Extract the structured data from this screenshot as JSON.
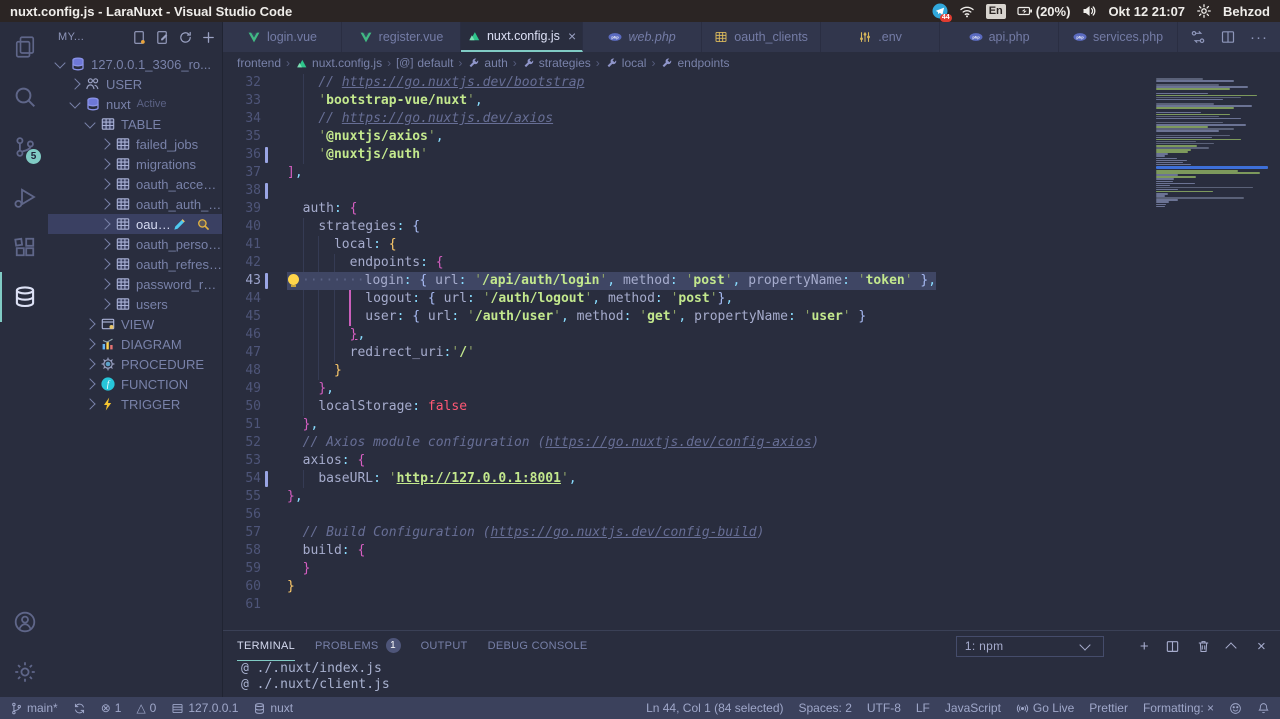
{
  "window": {
    "title": "nuxt.config.js - LaraNuxt - Visual Studio Code"
  },
  "tray": {
    "telegram_badge": "44",
    "keyboard_layout": "En",
    "battery": "(20%)",
    "clock": "Okt 12 21:07",
    "user": "Behzod"
  },
  "activity_bar": {
    "scm_badge": "5"
  },
  "sidebar": {
    "header": {
      "title": "MY..."
    },
    "tree": [
      {
        "label": "127.0.0.1_3306_ro...",
        "depth": 0,
        "icon": "database",
        "chevron": "open"
      },
      {
        "label": "USER",
        "depth": 1,
        "icon": "people",
        "chevron": "closed"
      },
      {
        "label": "nuxt",
        "badge": "Active",
        "depth": 1,
        "icon": "database",
        "chevron": "open"
      },
      {
        "label": "TABLE",
        "depth": 2,
        "icon": "grid",
        "chevron": "open"
      },
      {
        "label": "failed_jobs",
        "depth": 3,
        "icon": "grid",
        "chevron": "closed"
      },
      {
        "label": "migrations",
        "depth": 3,
        "icon": "grid",
        "chevron": "closed"
      },
      {
        "label": "oauth_access...",
        "depth": 3,
        "icon": "grid",
        "chevron": "closed"
      },
      {
        "label": "oauth_auth_c...",
        "depth": 3,
        "icon": "grid",
        "chevron": "closed"
      },
      {
        "label": "oauth_...",
        "depth": 3,
        "icon": "grid",
        "chevron": "closed",
        "selected": true,
        "actions": [
          "pencil",
          "magnifier"
        ]
      },
      {
        "label": "oauth_person...",
        "depth": 3,
        "icon": "grid",
        "chevron": "closed"
      },
      {
        "label": "oauth_refresh...",
        "depth": 3,
        "icon": "grid",
        "chevron": "closed"
      },
      {
        "label": "password_res...",
        "depth": 3,
        "icon": "grid",
        "chevron": "closed"
      },
      {
        "label": "users",
        "depth": 3,
        "icon": "grid",
        "chevron": "closed"
      },
      {
        "label": "VIEW",
        "depth": 2,
        "icon": "view",
        "chevron": "closed"
      },
      {
        "label": "DIAGRAM",
        "depth": 2,
        "icon": "diagram",
        "chevron": "closed"
      },
      {
        "label": "PROCEDURE",
        "depth": 2,
        "icon": "gear",
        "chevron": "closed"
      },
      {
        "label": "FUNCTION",
        "depth": 2,
        "icon": "func",
        "chevron": "closed"
      },
      {
        "label": "TRIGGER",
        "depth": 2,
        "icon": "bolt",
        "chevron": "closed"
      }
    ]
  },
  "tabs": [
    {
      "label": "login.vue",
      "icon": "vue"
    },
    {
      "label": "register.vue",
      "icon": "vue"
    },
    {
      "label": "nuxt.config.js",
      "icon": "nuxt",
      "active": true,
      "close": "×"
    },
    {
      "label": "web.php",
      "icon": "php",
      "preview": true
    },
    {
      "label": "oauth_clients",
      "icon": "gridy"
    },
    {
      "label": ".env",
      "icon": "env"
    },
    {
      "label": "api.php",
      "icon": "php"
    },
    {
      "label": "services.php",
      "icon": "php"
    }
  ],
  "breadcrumbs": [
    {
      "label": "frontend"
    },
    {
      "label": "nuxt.config.js",
      "icon": "nuxt"
    },
    {
      "label": "default",
      "icon": "module"
    },
    {
      "label": "auth",
      "icon": "wrench"
    },
    {
      "label": "strategies",
      "icon": "wrench"
    },
    {
      "label": "local",
      "icon": "wrench"
    },
    {
      "label": "endpoints",
      "icon": "wrench"
    }
  ],
  "editor": {
    "lines": [
      {
        "n": 32,
        "ind": 4,
        "tk": [
          [
            "    ",
            "pl"
          ],
          [
            "// ",
            "c"
          ],
          [
            "https://go.nuxtjs.dev/bootstrap",
            "cu"
          ]
        ]
      },
      {
        "n": 33,
        "ind": 4,
        "tk": [
          [
            "    ",
            "pl"
          ],
          [
            "'",
            "q"
          ],
          [
            "bootstrap-vue/nuxt",
            "s"
          ],
          [
            "'",
            "q"
          ],
          [
            ",",
            "p"
          ]
        ]
      },
      {
        "n": 34,
        "ind": 4,
        "tk": [
          [
            "    ",
            "pl"
          ],
          [
            "// ",
            "c"
          ],
          [
            "https://go.nuxtjs.dev/axios",
            "cu"
          ]
        ]
      },
      {
        "n": 35,
        "ind": 4,
        "tk": [
          [
            "    ",
            "pl"
          ],
          [
            "'",
            "q"
          ],
          [
            "@nuxtjs/axios",
            "s"
          ],
          [
            "'",
            "q"
          ],
          [
            ",",
            "p"
          ]
        ]
      },
      {
        "n": 36,
        "ind": 4,
        "git": true,
        "tk": [
          [
            "    ",
            "pl"
          ],
          [
            "'",
            "q"
          ],
          [
            "@nuxtjs/auth",
            "s"
          ],
          [
            "'",
            "q"
          ]
        ]
      },
      {
        "n": 37,
        "ind": 0,
        "tk": [
          [
            "]",
            "b2"
          ],
          [
            ",",
            "p"
          ]
        ]
      },
      {
        "n": 38,
        "ind": 0,
        "git": true,
        "tk": []
      },
      {
        "n": 39,
        "ind": 2,
        "tk": [
          [
            "  ",
            "pl"
          ],
          [
            "auth",
            "pl"
          ],
          [
            ": ",
            "p"
          ],
          [
            "{",
            "b2"
          ]
        ]
      },
      {
        "n": 40,
        "ind": 4,
        "tk": [
          [
            "    ",
            "pl"
          ],
          [
            "strategies",
            "pl"
          ],
          [
            ": ",
            "p"
          ],
          [
            "{",
            "b3"
          ]
        ]
      },
      {
        "n": 41,
        "ind": 6,
        "tk": [
          [
            "      ",
            "pl"
          ],
          [
            "local",
            "pl"
          ],
          [
            ": ",
            "p"
          ],
          [
            "{",
            "b1"
          ]
        ]
      },
      {
        "n": 42,
        "ind": 8,
        "tk": [
          [
            "        ",
            "pl"
          ],
          [
            "endpoints",
            "pl"
          ],
          [
            ": ",
            "p"
          ],
          [
            "{",
            "b2"
          ]
        ]
      },
      {
        "n": 43,
        "ind": 10,
        "sel": true,
        "git": true,
        "tk": [
          [
            "",
            "bulb"
          ],
          [
            "········",
            "ws"
          ],
          [
            "login",
            "pl"
          ],
          [
            ": ",
            "p"
          ],
          [
            "{ ",
            "b3"
          ],
          [
            "url",
            "pl"
          ],
          [
            ": ",
            "p"
          ],
          [
            "'",
            "q"
          ],
          [
            "/api/auth/login",
            "s"
          ],
          [
            "'",
            "q"
          ],
          [
            ", ",
            "p"
          ],
          [
            "method",
            "pl"
          ],
          [
            ": ",
            "p"
          ],
          [
            "'",
            "q"
          ],
          [
            "post",
            "s"
          ],
          [
            "'",
            "q"
          ],
          [
            ", ",
            "p"
          ],
          [
            "propertyName",
            "pl"
          ],
          [
            ": ",
            "p"
          ],
          [
            "'",
            "q"
          ],
          [
            "token",
            "s"
          ],
          [
            "'",
            "q"
          ],
          [
            " }",
            "b3"
          ],
          [
            ",",
            "p"
          ]
        ]
      },
      {
        "n": 44,
        "ind": 10,
        "pg": 8,
        "tk": [
          [
            "          ",
            "pl"
          ],
          [
            "logout",
            "pl"
          ],
          [
            ": ",
            "p"
          ],
          [
            "{ ",
            "b3"
          ],
          [
            "url",
            "pl"
          ],
          [
            ": ",
            "p"
          ],
          [
            "'",
            "q"
          ],
          [
            "/auth/logout",
            "s"
          ],
          [
            "'",
            "q"
          ],
          [
            ", ",
            "p"
          ],
          [
            "method",
            "pl"
          ],
          [
            ": ",
            "p"
          ],
          [
            "'",
            "q"
          ],
          [
            "post",
            "s"
          ],
          [
            "'",
            "q"
          ],
          [
            "}",
            "b3"
          ],
          [
            ",",
            "p"
          ]
        ]
      },
      {
        "n": 45,
        "ind": 10,
        "pg": 8,
        "tk": [
          [
            "          ",
            "pl"
          ],
          [
            "user",
            "pl"
          ],
          [
            ": ",
            "p"
          ],
          [
            "{ ",
            "b3"
          ],
          [
            "url",
            "pl"
          ],
          [
            ": ",
            "p"
          ],
          [
            "'",
            "q"
          ],
          [
            "/auth/user",
            "s"
          ],
          [
            "'",
            "q"
          ],
          [
            ", ",
            "p"
          ],
          [
            "method",
            "pl"
          ],
          [
            ": ",
            "p"
          ],
          [
            "'",
            "q"
          ],
          [
            "get",
            "s"
          ],
          [
            "'",
            "q"
          ],
          [
            ", ",
            "p"
          ],
          [
            "propertyName",
            "pl"
          ],
          [
            ": ",
            "p"
          ],
          [
            "'",
            "q"
          ],
          [
            "user",
            "s"
          ],
          [
            "'",
            "q"
          ],
          [
            " }",
            "b3"
          ]
        ]
      },
      {
        "n": 46,
        "ind": 8,
        "tk": [
          [
            "        ",
            "pl"
          ],
          [
            "}",
            "b2 bm"
          ],
          [
            ",",
            "p"
          ]
        ]
      },
      {
        "n": 47,
        "ind": 8,
        "tk": [
          [
            "        ",
            "pl"
          ],
          [
            "redirect_uri",
            "pl"
          ],
          [
            ":",
            "p"
          ],
          [
            "'",
            "q"
          ],
          [
            "/",
            "s"
          ],
          [
            "'",
            "q"
          ]
        ]
      },
      {
        "n": 48,
        "ind": 6,
        "tk": [
          [
            "      ",
            "pl"
          ],
          [
            "}",
            "b1"
          ]
        ]
      },
      {
        "n": 49,
        "ind": 4,
        "tk": [
          [
            "    ",
            "pl"
          ],
          [
            "}",
            "b2"
          ],
          [
            ",",
            "p"
          ]
        ]
      },
      {
        "n": 50,
        "ind": 4,
        "tk": [
          [
            "    ",
            "pl"
          ],
          [
            "localStorage",
            "pl"
          ],
          [
            ": ",
            "p"
          ],
          [
            "false",
            "bool"
          ]
        ]
      },
      {
        "n": 51,
        "ind": 2,
        "tk": [
          [
            "  ",
            "pl"
          ],
          [
            "}",
            "b2"
          ],
          [
            ",",
            "p"
          ]
        ]
      },
      {
        "n": 52,
        "ind": 2,
        "tk": [
          [
            "  ",
            "pl"
          ],
          [
            "// Axios module configuration (",
            "c"
          ],
          [
            "https://go.nuxtjs.dev/config-axios",
            "cu"
          ],
          [
            ")",
            "c"
          ]
        ]
      },
      {
        "n": 53,
        "ind": 2,
        "tk": [
          [
            "  ",
            "pl"
          ],
          [
            "axios",
            "pl"
          ],
          [
            ": ",
            "p"
          ],
          [
            "{",
            "b2"
          ]
        ]
      },
      {
        "n": 54,
        "ind": 4,
        "git": true,
        "tk": [
          [
            "    ",
            "pl"
          ],
          [
            "baseURL",
            "pl"
          ],
          [
            ": ",
            "p"
          ],
          [
            "'",
            "q"
          ],
          [
            "http://127.0.0.1:8001",
            "su"
          ],
          [
            "'",
            "q"
          ],
          [
            ",",
            "p"
          ]
        ]
      },
      {
        "n": 55,
        "ind": 0,
        "tk": [
          [
            "}",
            "b2"
          ],
          [
            ",",
            "p"
          ]
        ]
      },
      {
        "n": 56,
        "ind": 0,
        "tk": []
      },
      {
        "n": 57,
        "ind": 2,
        "tk": [
          [
            "  ",
            "pl"
          ],
          [
            "// Build Configuration (",
            "c"
          ],
          [
            "https://go.nuxtjs.dev/config-build",
            "cu"
          ],
          [
            ")",
            "c"
          ]
        ]
      },
      {
        "n": 58,
        "ind": 2,
        "tk": [
          [
            "  ",
            "pl"
          ],
          [
            "build",
            "pl"
          ],
          [
            ": ",
            "p"
          ],
          [
            "{",
            "b2"
          ]
        ]
      },
      {
        "n": 59,
        "ind": 2,
        "tk": [
          [
            "  ",
            "pl"
          ],
          [
            "}",
            "b2"
          ]
        ]
      },
      {
        "n": 60,
        "ind": 0,
        "tk": [
          [
            "}",
            "b1"
          ]
        ]
      },
      {
        "n": 61,
        "ind": 0,
        "tk": []
      }
    ]
  },
  "panel": {
    "tabs": [
      {
        "label": "TERMINAL",
        "active": true
      },
      {
        "label": "PROBLEMS",
        "badge": "1"
      },
      {
        "label": "OUTPUT"
      },
      {
        "label": "DEBUG CONSOLE"
      }
    ],
    "dropdown_value": "1: npm",
    "lines": [
      "@ ./.nuxt/index.js",
      "@ ./.nuxt/client.js"
    ]
  },
  "status_bar": {
    "left": [
      {
        "icon": "branch",
        "label": "main*",
        "name": "git-branch"
      },
      {
        "icon": "sync",
        "label": "",
        "name": "git-sync"
      },
      {
        "icon": "error",
        "label": "1",
        "name": "errors"
      },
      {
        "icon": "warning",
        "label": "0",
        "name": "warnings"
      },
      {
        "icon": "server",
        "label": "127.0.0.1",
        "name": "db-host"
      },
      {
        "icon": "dbsmall",
        "label": "nuxt",
        "name": "db-name"
      }
    ],
    "right": [
      {
        "label": "Ln 44, Col 1 (84 selected)",
        "name": "cursor-position"
      },
      {
        "label": "Spaces: 2",
        "name": "indentation"
      },
      {
        "label": "UTF-8",
        "name": "encoding"
      },
      {
        "label": "LF",
        "name": "eol"
      },
      {
        "label": "JavaScript",
        "name": "language-mode"
      },
      {
        "icon": "broadcast",
        "label": "Go Live",
        "name": "go-live"
      },
      {
        "label": "Prettier",
        "name": "prettier"
      },
      {
        "label": "Formatting: ×",
        "name": "formatting"
      },
      {
        "icon": "feedback",
        "label": "",
        "name": "feedback"
      },
      {
        "icon": "bell",
        "label": "",
        "name": "notifications"
      }
    ]
  },
  "colors": {
    "accent": "#80CBC4",
    "editor_bg": "#292D3E",
    "string": "#C3E88D",
    "comment": "#676E95",
    "bracket_gold": "#FFCB6B",
    "bracket_orchid": "#D75FC3",
    "bracket_blue": "#A9BCF5",
    "boolean_false": "#FF5874",
    "selection": "#717CB4"
  }
}
